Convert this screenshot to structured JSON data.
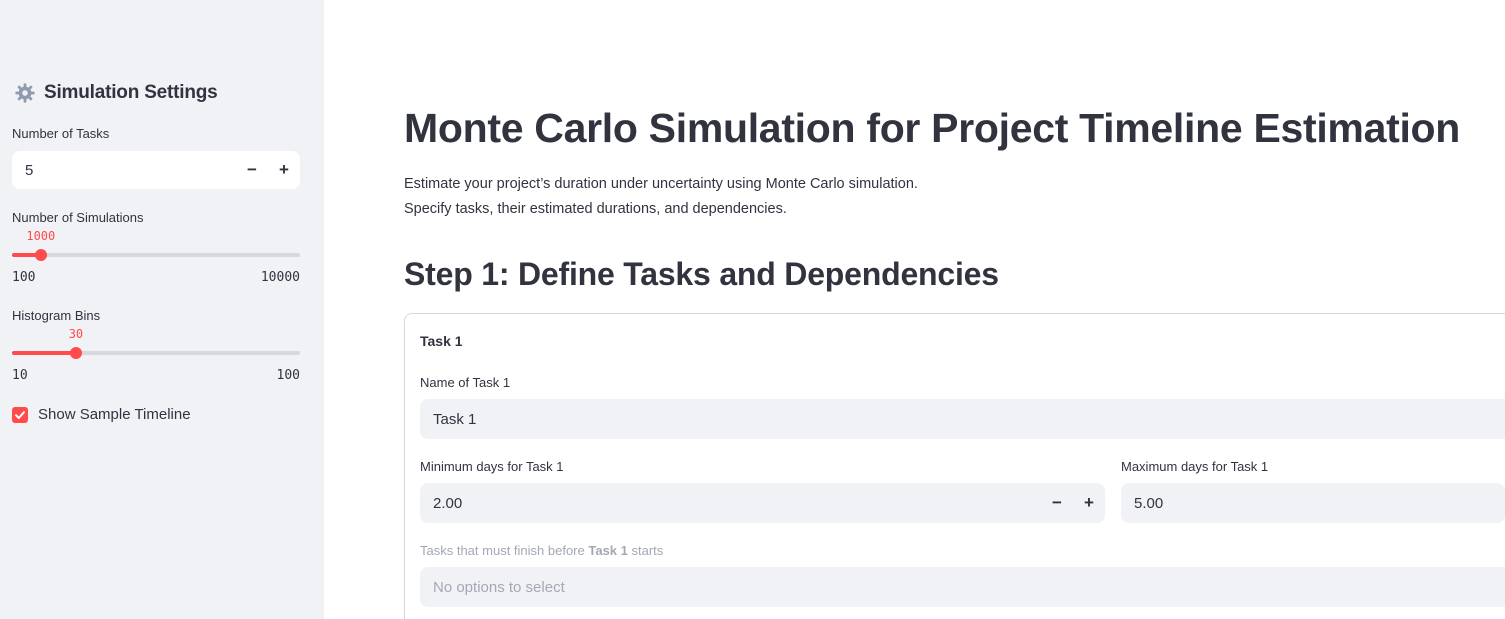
{
  "sidebar": {
    "header": {
      "title": "Simulation Settings",
      "icon": "gear-icon"
    },
    "num_tasks": {
      "label": "Number of Tasks",
      "value": "5",
      "minus": "−",
      "plus": "+"
    },
    "num_simulations": {
      "label": "Number of Simulations",
      "value": "1000",
      "min": "100",
      "max": "10000",
      "fraction": 0.1
    },
    "histogram_bins": {
      "label": "Histogram Bins",
      "value": "30",
      "min": "10",
      "max": "100",
      "fraction": 0.222
    },
    "show_timeline": {
      "label": "Show Sample Timeline",
      "checked": true
    }
  },
  "main": {
    "title": "Monte Carlo Simulation for Project Timeline Estimation",
    "intro_line1": "Estimate your project’s duration under uncertainty using Monte Carlo simulation.",
    "intro_line2": "Specify tasks, their estimated durations, and dependencies.",
    "step1_title": "Step 1: Define Tasks and Dependencies",
    "task_card": {
      "title": "Task 1",
      "name_label": "Name of Task 1",
      "name_value": "Task 1",
      "min_label": "Minimum days for Task 1",
      "min_value": "2.00",
      "max_label": "Maximum days for Task 1",
      "max_value": "5.00",
      "deps_label_prefix": "Tasks that must finish before ",
      "deps_label_task": "Task 1",
      "deps_label_suffix": " starts",
      "deps_placeholder": "No options to select"
    }
  },
  "colors": {
    "accent": "#ff4b4b",
    "sidebar_bg": "#f0f2f6",
    "text": "#31333f",
    "muted": "#a3a8b4"
  }
}
